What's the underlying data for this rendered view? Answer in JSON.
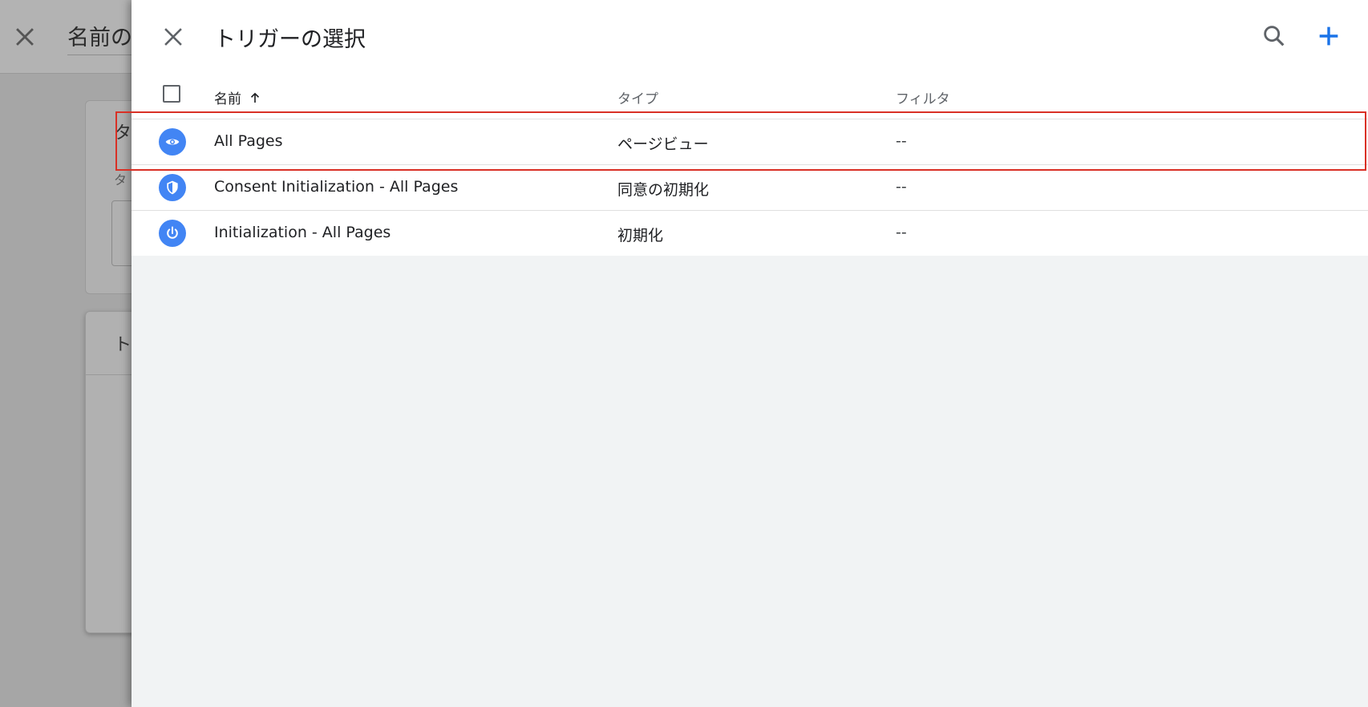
{
  "background": {
    "title": "名前の",
    "card1_heading": "タ",
    "card1_sub": "タ",
    "card2_heading": "ト"
  },
  "panel": {
    "title": "トリガーの選択",
    "columns": {
      "name": "名前",
      "type": "タイプ",
      "filter": "フィルタ"
    },
    "rows": [
      {
        "icon": "eye-icon",
        "name": "All Pages",
        "type": "ページビュー",
        "filter": "--"
      },
      {
        "icon": "shield-icon",
        "name": "Consent Initialization - All Pages",
        "type": "同意の初期化",
        "filter": "--"
      },
      {
        "icon": "power-icon",
        "name": "Initialization - All Pages",
        "type": "初期化",
        "filter": "--"
      }
    ]
  },
  "colors": {
    "accent": "#1a73e8",
    "trigger_icon_bg": "#4285f4",
    "highlight": "#d93025"
  }
}
